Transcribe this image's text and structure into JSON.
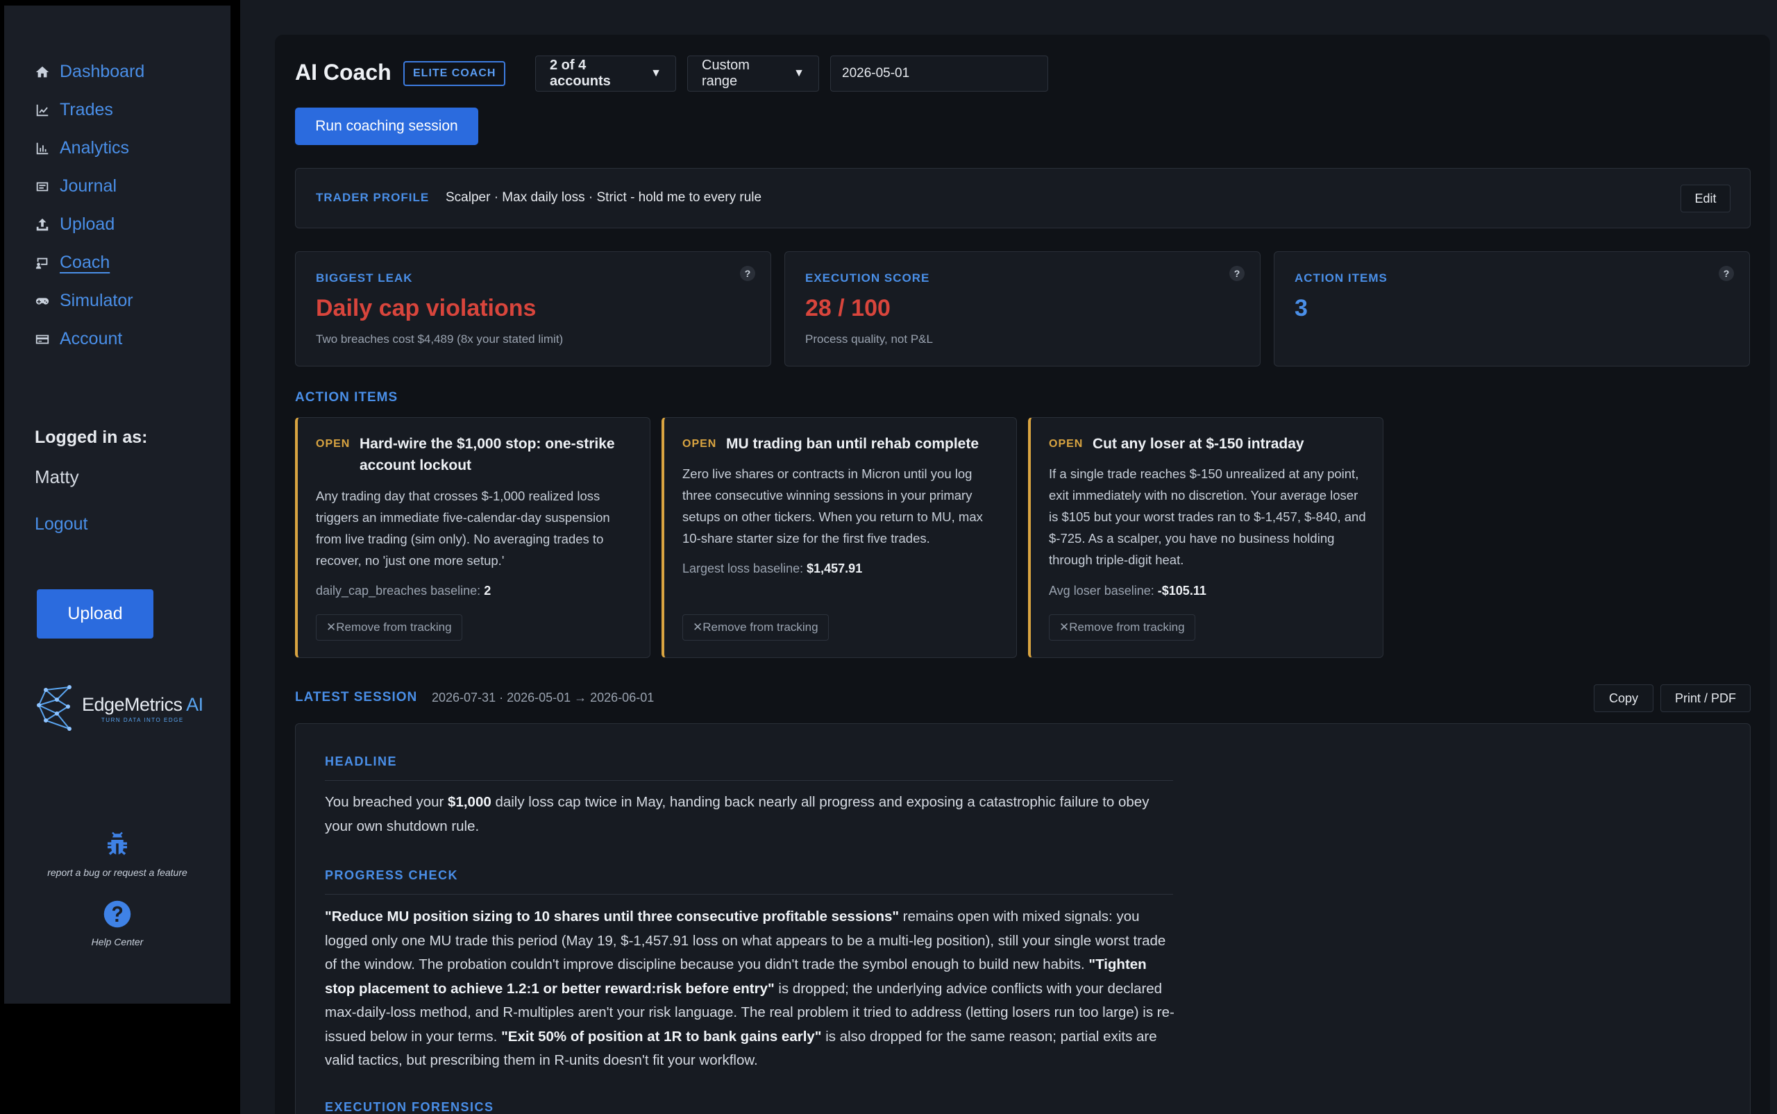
{
  "sidebar": {
    "nav": [
      {
        "label": "Dashboard",
        "icon": "home-icon"
      },
      {
        "label": "Trades",
        "icon": "line-chart-icon"
      },
      {
        "label": "Analytics",
        "icon": "bar-chart-icon"
      },
      {
        "label": "Journal",
        "icon": "journal-icon"
      },
      {
        "label": "Upload",
        "icon": "upload-icon"
      },
      {
        "label": "Coach",
        "icon": "coach-icon"
      },
      {
        "label": "Simulator",
        "icon": "gamepad-icon"
      },
      {
        "label": "Account",
        "icon": "credit-card-icon"
      }
    ],
    "active": "Coach",
    "logged_in_label": "Logged in as:",
    "user": "Matty",
    "logout": "Logout",
    "upload_button": "Upload",
    "brand_name": "EdgeMetrics",
    "brand_ai": "AI",
    "brand_tagline": "TURN DATA INTO EDGE",
    "bug_text": "report a bug or request a feature",
    "help_text": "Help Center"
  },
  "header": {
    "title": "AI Coach",
    "badge": "ELITE COACH",
    "accounts_select": "2 of 4 accounts",
    "range_select": "Custom range",
    "date_value": "2026-05-01",
    "run_button": "Run coaching session"
  },
  "profile": {
    "label": "TRADER PROFILE",
    "value": "Scalper · Max daily loss · Strict - hold me to every rule",
    "edit": "Edit"
  },
  "metrics": [
    {
      "label": "BIGGEST LEAK",
      "value": "Daily cap violations",
      "sub": "Two breaches cost $4,489 (8x your stated limit)",
      "color": "#d8453c"
    },
    {
      "label": "EXECUTION SCORE",
      "value": "28 / 100",
      "sub": "Process quality, not P&L",
      "color": "#d8453c"
    },
    {
      "label": "ACTION ITEMS",
      "value": "3",
      "sub": "",
      "color": "#4a8fe8"
    }
  ],
  "action_items": {
    "heading": "ACTION ITEMS",
    "remove_label": "Remove from tracking",
    "items": [
      {
        "status": "OPEN",
        "title": "Hard-wire the $1,000 stop: one-strike account lockout",
        "body": "Any trading day that crosses $-1,000 realized loss triggers an immediate five-calendar-day suspension from live trading (sim only). No averaging trades to recover, no 'just one more setup.'",
        "baseline_label": "daily_cap_breaches baseline:",
        "baseline_value": "2"
      },
      {
        "status": "OPEN",
        "title": "MU trading ban until rehab complete",
        "body": "Zero live shares or contracts in Micron until you log three consecutive winning sessions in your primary setups on other tickers. When you return to MU, max 10-share starter size for the first five trades.",
        "baseline_label": "Largest loss baseline:",
        "baseline_value": "$1,457.91"
      },
      {
        "status": "OPEN",
        "title": "Cut any loser at $-150 intraday",
        "body": "If a single trade reaches $-150 unrealized at any point, exit immediately with no discretion. Your average loser is $105 but your worst trades ran to $-1,457, $-840, and $-725. As a scalper, you have no business holding through triple-digit heat.",
        "baseline_label": "Avg loser baseline:",
        "baseline_value": "-$105.11"
      }
    ]
  },
  "session": {
    "heading": "LATEST SESSION",
    "range": "2026-07-31 · 2026-05-01 → 2026-06-01",
    "copy": "Copy",
    "print": "Print / PDF",
    "headline_label": "HEADLINE",
    "headline_pre": "You breached your ",
    "headline_bold": "$1,000",
    "headline_post": " daily loss cap twice in May, handing back nearly all progress and exposing a catastrophic failure to obey your own shutdown rule.",
    "progress_label": "PROGRESS CHECK",
    "p1_bold": "\"Reduce MU position sizing to 10 shares until three consecutive profitable sessions\"",
    "p1_text": " remains open with mixed signals: you logged only one MU trade this period (May 19, $-1,457.91 loss on what appears to be a multi-leg position), still your single worst trade of the window. The probation couldn't improve discipline because you didn't trade the symbol enough to build new habits. ",
    "p2_bold": "\"Tighten stop placement to achieve 1.2:1 or better reward:risk before entry\"",
    "p2_text": " is dropped; the underlying advice conflicts with your declared max-daily-loss method, and R-multiples aren't your risk language. The real problem it tried to address (letting losers run too large) is re-issued below in your terms. ",
    "p3_bold": "\"Exit 50% of position at 1R to bank gains early\"",
    "p3_text": " is also dropped for the same reason; partial exits are valid tactics, but prescribing them in R-units doesn't fit your workflow.",
    "forensics_label": "EXECUTION FORENSICS"
  }
}
